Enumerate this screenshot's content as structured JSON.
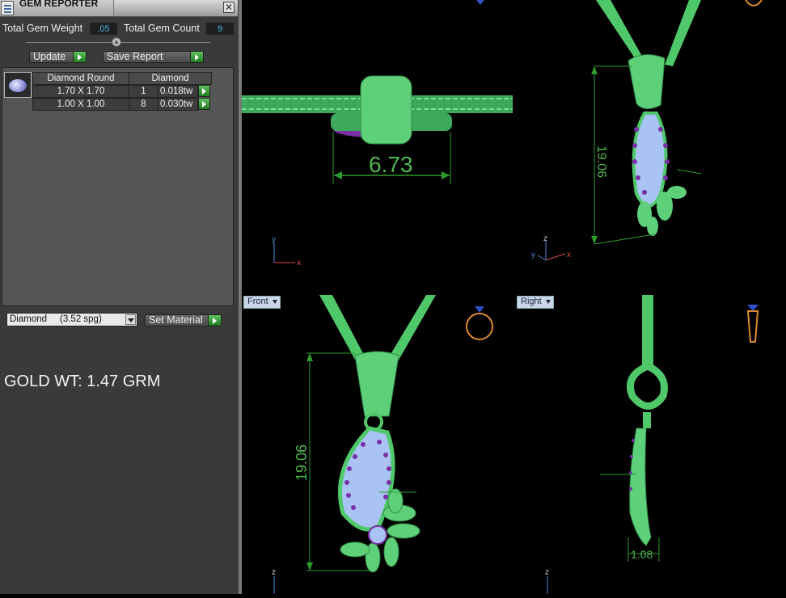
{
  "panel": {
    "title": "GEM REPORTER",
    "close_label": "✕",
    "total_gem_weight_label": "Total Gem Weight",
    "total_gem_weight_value": ".05",
    "total_gem_count_label": "Total Gem Count",
    "total_gem_count_value": "9",
    "update_label": "Update",
    "save_report_label": "Save Report",
    "gem_table": {
      "headers": [
        "Diamond Round",
        "Diamond"
      ],
      "rows": [
        {
          "size": "1.70 X 1.70",
          "count": "1",
          "weight": "0.018tw"
        },
        {
          "size": "1.00 X 1.00",
          "count": "8",
          "weight": "0.030tw"
        }
      ]
    },
    "material_select": "Diamond     (3.52 spg)",
    "set_material_label": "Set Material",
    "gold_weight": "GOLD WT: 1.47 GRM"
  },
  "viewports": {
    "top_left": {
      "dimension": "6.73",
      "axis_y": "y",
      "axis_x": "x"
    },
    "top_right": {
      "dimension": "19.06",
      "axis_z": "z",
      "axis_y": "y",
      "axis_x": "x"
    },
    "bottom_left": {
      "label": "Front",
      "dimension": "19.06",
      "axis_z": "z"
    },
    "bottom_right": {
      "label": "Right",
      "dimension": "1.08",
      "axis_z": "z"
    }
  },
  "colors": {
    "model_green": "#4fc86a",
    "dimension_green": "#3fa83f",
    "gem_blue": "#a9c4f4",
    "gem_purple": "#7a2fa8"
  }
}
